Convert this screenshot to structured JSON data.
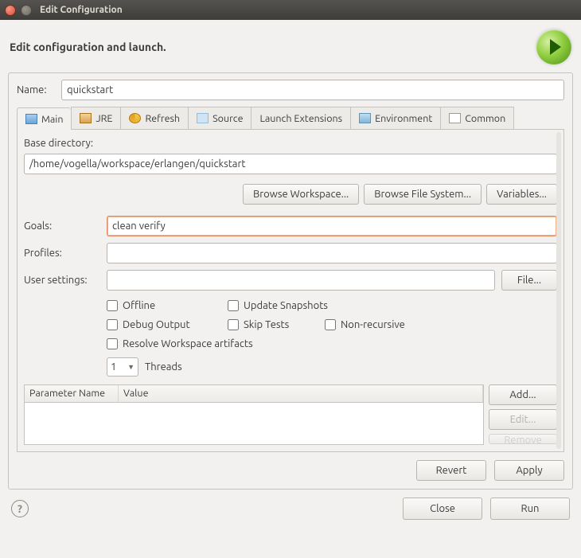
{
  "window": {
    "title": "Edit Configuration"
  },
  "header": {
    "heading": "Edit configuration and launch."
  },
  "name": {
    "label": "Name:",
    "value": "quickstart"
  },
  "tabs": {
    "main": "Main",
    "jre": "JRE",
    "refresh": "Refresh",
    "source": "Source",
    "launch_ext": "Launch Extensions",
    "environment": "Environment",
    "common": "Common"
  },
  "main": {
    "base_dir_label": "Base directory:",
    "base_dir_value": "/home/vogella/workspace/erlangen/quickstart",
    "browse_workspace": "Browse Workspace...",
    "browse_fs": "Browse File System...",
    "variables": "Variables...",
    "goals_label": "Goals:",
    "goals_value": "clean verify",
    "profiles_label": "Profiles:",
    "profiles_value": "",
    "user_settings_label": "User settings:",
    "user_settings_value": "",
    "file_btn": "File...",
    "chk_offline": "Offline",
    "chk_update_snapshots": "Update Snapshots",
    "chk_debug_output": "Debug Output",
    "chk_skip_tests": "Skip Tests",
    "chk_non_recursive": "Non-recursive",
    "chk_resolve": "Resolve Workspace artifacts",
    "threads_value": "1",
    "threads_label": "Threads",
    "table": {
      "col_param": "Parameter Name",
      "col_value": "Value"
    },
    "btn_add": "Add...",
    "btn_edit": "Edit...",
    "btn_remove": "Remove"
  },
  "panel_footer": {
    "revert": "Revert",
    "apply": "Apply"
  },
  "footer": {
    "close": "Close",
    "run": "Run"
  }
}
